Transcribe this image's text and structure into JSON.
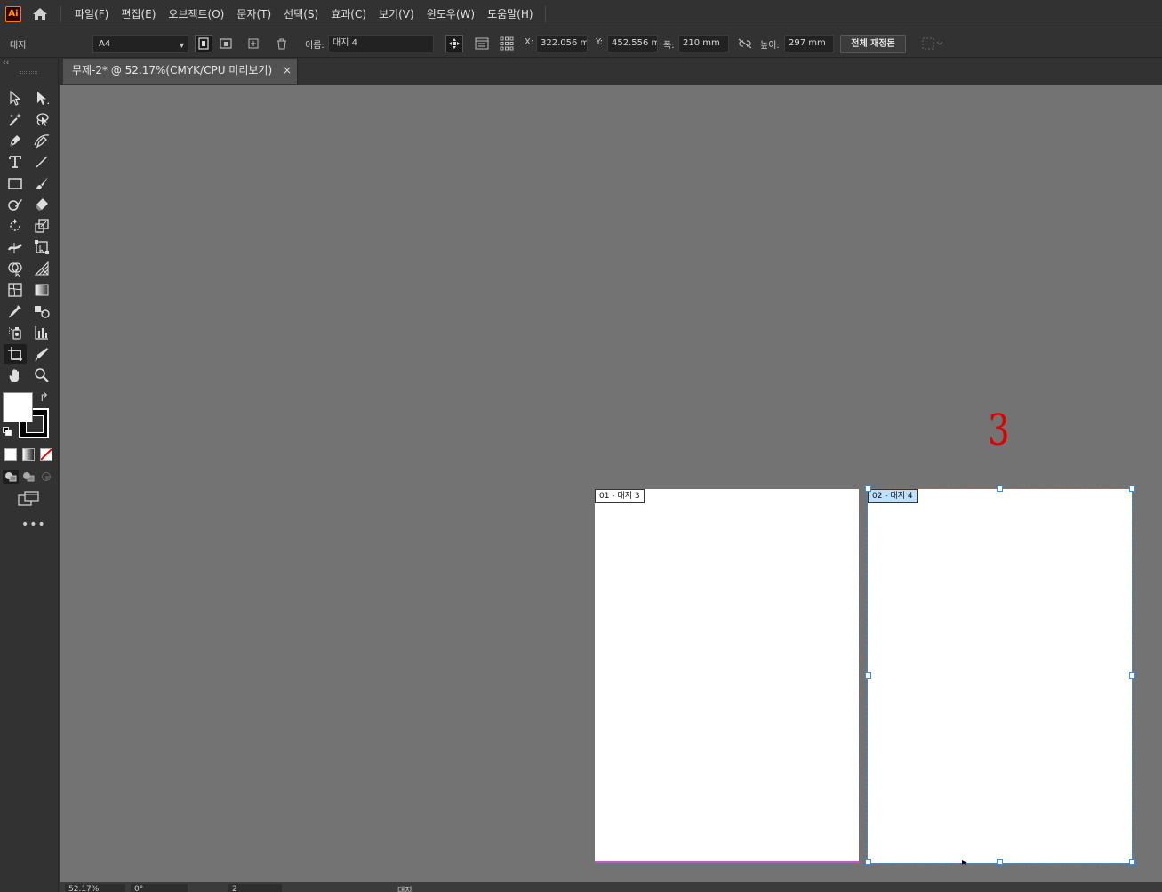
{
  "app": {
    "logo_text": "Ai",
    "brand_color": "#ff9a00"
  },
  "menu": [
    "파일(F)",
    "편집(E)",
    "오브젝트(O)",
    "문자(T)",
    "선택(S)",
    "효과(C)",
    "보기(V)",
    "윈도우(W)",
    "도움말(H)"
  ],
  "control": {
    "panel_label": "대지",
    "preset": "A4",
    "name_label": "이름:",
    "name_value": "대지 4",
    "x_label": "X:",
    "x_value": "322.056 m",
    "y_label": "Y:",
    "y_value": "452.556 m",
    "w_label": "폭:",
    "w_value": "210 mm",
    "h_label": "높이:",
    "h_value": "297 mm",
    "rearrange_button": "전체 재정돈"
  },
  "toolbar": {
    "collapse": "‹‹",
    "swap": "↱",
    "more": "•••",
    "selected_tool": "artboard-tool",
    "tools": [
      {
        "name": "selection-tool-icon"
      },
      {
        "name": "direct-selection-tool-icon"
      },
      {
        "name": "magic-wand-tool-icon"
      },
      {
        "name": "lasso-tool-icon"
      },
      {
        "name": "pen-tool-icon"
      },
      {
        "name": "curvature-tool-icon"
      },
      {
        "name": "type-tool-icon"
      },
      {
        "name": "line-segment-tool-icon"
      },
      {
        "name": "rectangle-tool-icon"
      },
      {
        "name": "paintbrush-tool-icon"
      },
      {
        "name": "shaper-tool-icon"
      },
      {
        "name": "eraser-tool-icon"
      },
      {
        "name": "rotate-tool-icon"
      },
      {
        "name": "scale-tool-icon"
      },
      {
        "name": "width-tool-icon"
      },
      {
        "name": "free-transform-tool-icon"
      },
      {
        "name": "shape-builder-tool-icon"
      },
      {
        "name": "perspective-grid-tool-icon"
      },
      {
        "name": "mesh-tool-icon"
      },
      {
        "name": "gradient-tool-icon"
      },
      {
        "name": "eyedropper-tool-icon"
      },
      {
        "name": "blend-tool-icon"
      },
      {
        "name": "symbol-sprayer-tool-icon"
      },
      {
        "name": "column-graph-tool-icon"
      },
      {
        "name": "artboard-tool-icon"
      },
      {
        "name": "slice-tool-icon"
      },
      {
        "name": "hand-tool-icon"
      },
      {
        "name": "zoom-tool-icon"
      }
    ],
    "fill_color": "#ffffff",
    "stroke_color": "#000000"
  },
  "document": {
    "tab_title": "무제-2* @ 52.17%(CMYK/CPU 미리보기)",
    "close": "×"
  },
  "canvas": {
    "background": "#737373",
    "annotation": "3",
    "artboards": [
      {
        "label": "01 - 대지 3",
        "selected": false
      },
      {
        "label": "02 - 대지 4",
        "selected": true
      }
    ]
  },
  "status": {
    "zoom": "52.17%",
    "rotation": "0°",
    "artboard_number": "2",
    "tool_name": "대지"
  }
}
